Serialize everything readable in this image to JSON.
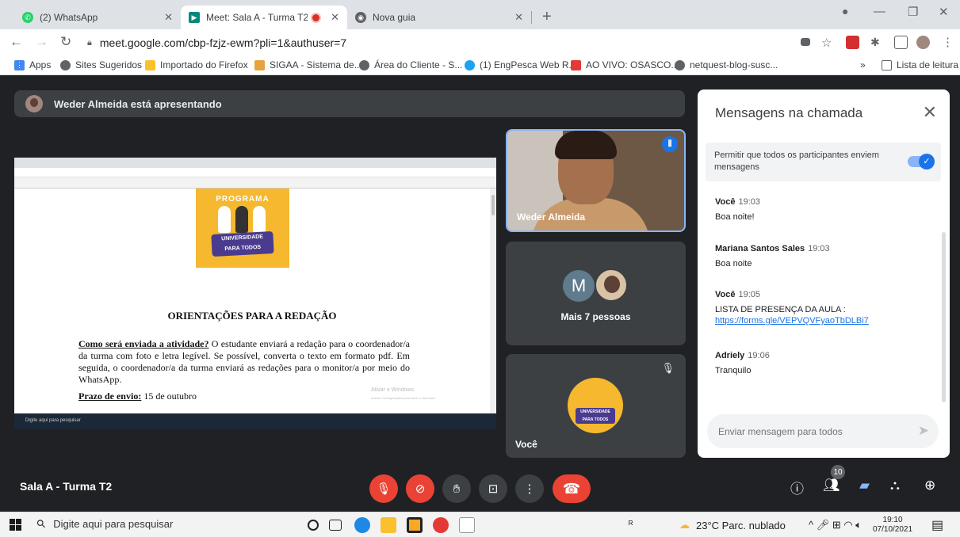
{
  "browser": {
    "tabs": [
      {
        "title": "(2) WhatsApp",
        "icon": "whatsapp-icon"
      },
      {
        "title": "Meet: Sala A - Turma T2",
        "icon": "meet-icon"
      },
      {
        "title": "Nova guia",
        "icon": "chrome-icon"
      }
    ],
    "url": "meet.google.com/cbp-fzjz-ewm?pli=1&authuser=7",
    "bookmarks": [
      "Apps",
      "Sites Sugeridos",
      "Importado do Firefox",
      "SIGAA - Sistema de...",
      "Área do Cliente - S...",
      "(1) EngPesca Web R...",
      "AO VIVO: OSASCO...",
      "netquest-blog-susc..."
    ],
    "bookmarks_more": "»",
    "reading_list": "Lista de leitura"
  },
  "meet": {
    "presenting_banner": "Weder Almeida está apresentando",
    "shared_doc": {
      "program_label": "PROGRAMA",
      "program_name_line1": "UNIVERSIDADE",
      "program_name_line2": "PARA TODOS",
      "title": "ORIENTAÇÕES PARA A REDAÇÃO",
      "p1_heading": "Como será enviada a atividade?",
      "p1_text": " O estudante enviará a redação para o coordenador/a da turma com foto e letra legível. Se possível, converta o texto em formato pdf. Em seguida, o coordenador/a da turma enviará as redações para o monitor/a por meio do WhatsApp.",
      "p2_heading": "Prazo de envio:",
      "p2_text": " 15 de outubro",
      "watermark_line1": "Ativar o Windows",
      "watermark_line2": "Acesse Configurações para ativar o Windows.",
      "inner_search": "Digite aqui para pesquisar"
    },
    "tiles": {
      "presenter_name": "Weder Almeida",
      "others_initial": "M",
      "others_label": "Mais 7 pessoas",
      "self_name": "Você"
    },
    "room_name": "Sala A - Turma T2",
    "participant_count": "10"
  },
  "chat": {
    "title": "Mensagens na chamada",
    "allow_text": "Permitir que todos os participantes enviem mensagens",
    "messages": [
      {
        "sender": "Você",
        "time": "19:03",
        "body": "Boa noite!"
      },
      {
        "sender": "Mariana Santos Sales",
        "time": "19:03",
        "body": "Boa noite"
      },
      {
        "sender": "Você",
        "time": "19:05",
        "body": "LISTA DE PRESENÇA DA AULA :",
        "link": "https://forms.gle/VEPVQVFyaoTbDLBi7"
      },
      {
        "sender": "Adriely",
        "time": "19:06",
        "body": "Tranquilo"
      }
    ],
    "input_placeholder": "Enviar mensagem para todos"
  },
  "taskbar": {
    "search_placeholder": "Digite aqui para pesquisar",
    "weather": "23°C  Parc. nublado",
    "time": "19:10",
    "date": "07/10/2021"
  },
  "colors": {
    "meet_bg": "#202124",
    "tile_bg": "#3c4043",
    "accent": "#1a73e8",
    "hangup": "#ea4335"
  }
}
